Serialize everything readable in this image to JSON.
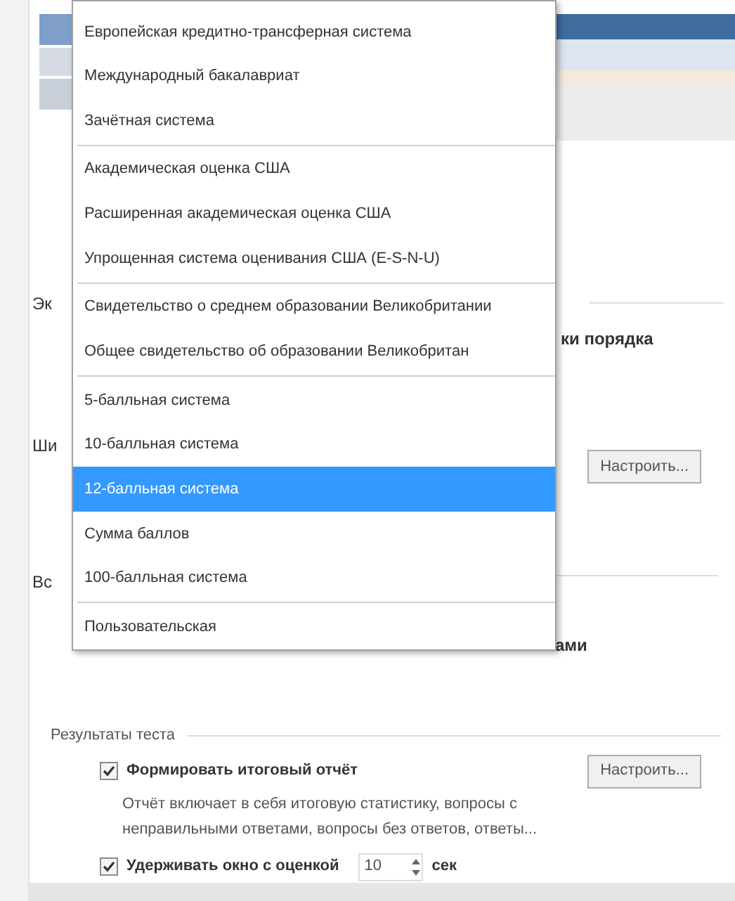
{
  "dialog": {
    "left_labels": [
      "Эк",
      "Ши",
      "Вс"
    ],
    "order_label": "ки порядка",
    "configure_button": "Настроить...",
    "lower_label": "ами"
  },
  "results": {
    "title": "Результаты теста",
    "report": {
      "label": "Формировать итоговый отчёт",
      "checked": true,
      "button": "Настроить...",
      "description": "Отчёт включает в себя итоговую статистику, вопросы с неправильными ответами, вопросы без ответов, ответы..."
    },
    "hold": {
      "label": "Удерживать окно с оценкой",
      "checked": true,
      "value": "10",
      "unit": "сек"
    }
  },
  "menu": {
    "items": [
      {
        "kind": "option",
        "label": "Европейская кредитно-трансферная система",
        "selected": false
      },
      {
        "kind": "option",
        "label": "Международный бакалавриат",
        "selected": false
      },
      {
        "kind": "option",
        "label": "Зачётная система",
        "selected": false
      },
      {
        "kind": "separator"
      },
      {
        "kind": "option",
        "label": "Академическая оценка США",
        "selected": false
      },
      {
        "kind": "option",
        "label": "Расширенная академическая оценка США",
        "selected": false
      },
      {
        "kind": "option",
        "label": "Упрощенная система оценивания США (E-S-N-U)",
        "selected": false
      },
      {
        "kind": "separator"
      },
      {
        "kind": "option",
        "label": "Свидетельство о среднем образовании Великобритании",
        "selected": false
      },
      {
        "kind": "option",
        "label": "Общее свидетельство об образовании Великобритан",
        "selected": false
      },
      {
        "kind": "separator"
      },
      {
        "kind": "option",
        "label": "5-балльная система",
        "selected": false
      },
      {
        "kind": "option",
        "label": "10-балльная система",
        "selected": false
      },
      {
        "kind": "option",
        "label": "12-балльная система",
        "selected": true
      },
      {
        "kind": "option",
        "label": "Сумма баллов",
        "selected": false
      },
      {
        "kind": "option",
        "label": "100-балльная система",
        "selected": false
      },
      {
        "kind": "separator"
      },
      {
        "kind": "option",
        "label": "Пользовательская",
        "selected": false
      }
    ]
  }
}
